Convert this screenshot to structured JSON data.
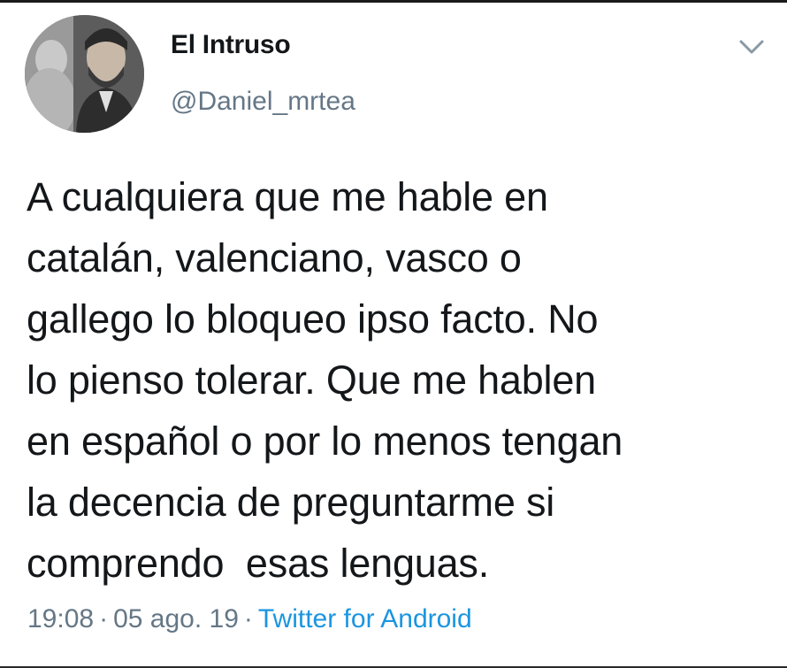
{
  "author": {
    "name": "El Intruso",
    "handle": "@Daniel_mrtea"
  },
  "tweet": {
    "text": "A cualquiera que me hable en\ncatalán, valenciano, vasco o\ngallego lo bloqueo ipso facto. No\nlo pienso tolerar. Que me hablen\nen español o por lo menos tengan\nla decencia de preguntarme si\ncomprendo  esas lenguas."
  },
  "meta": {
    "time": "19:08",
    "date": "05 ago. 19",
    "separator": "·",
    "source": "Twitter for Android"
  },
  "icons": {
    "menu": "chevron-down-icon",
    "avatar": "avatar-photo"
  },
  "colors": {
    "text": "#14171a",
    "secondary": "#657786",
    "link": "#1b95e0",
    "background": "#ffffff"
  }
}
